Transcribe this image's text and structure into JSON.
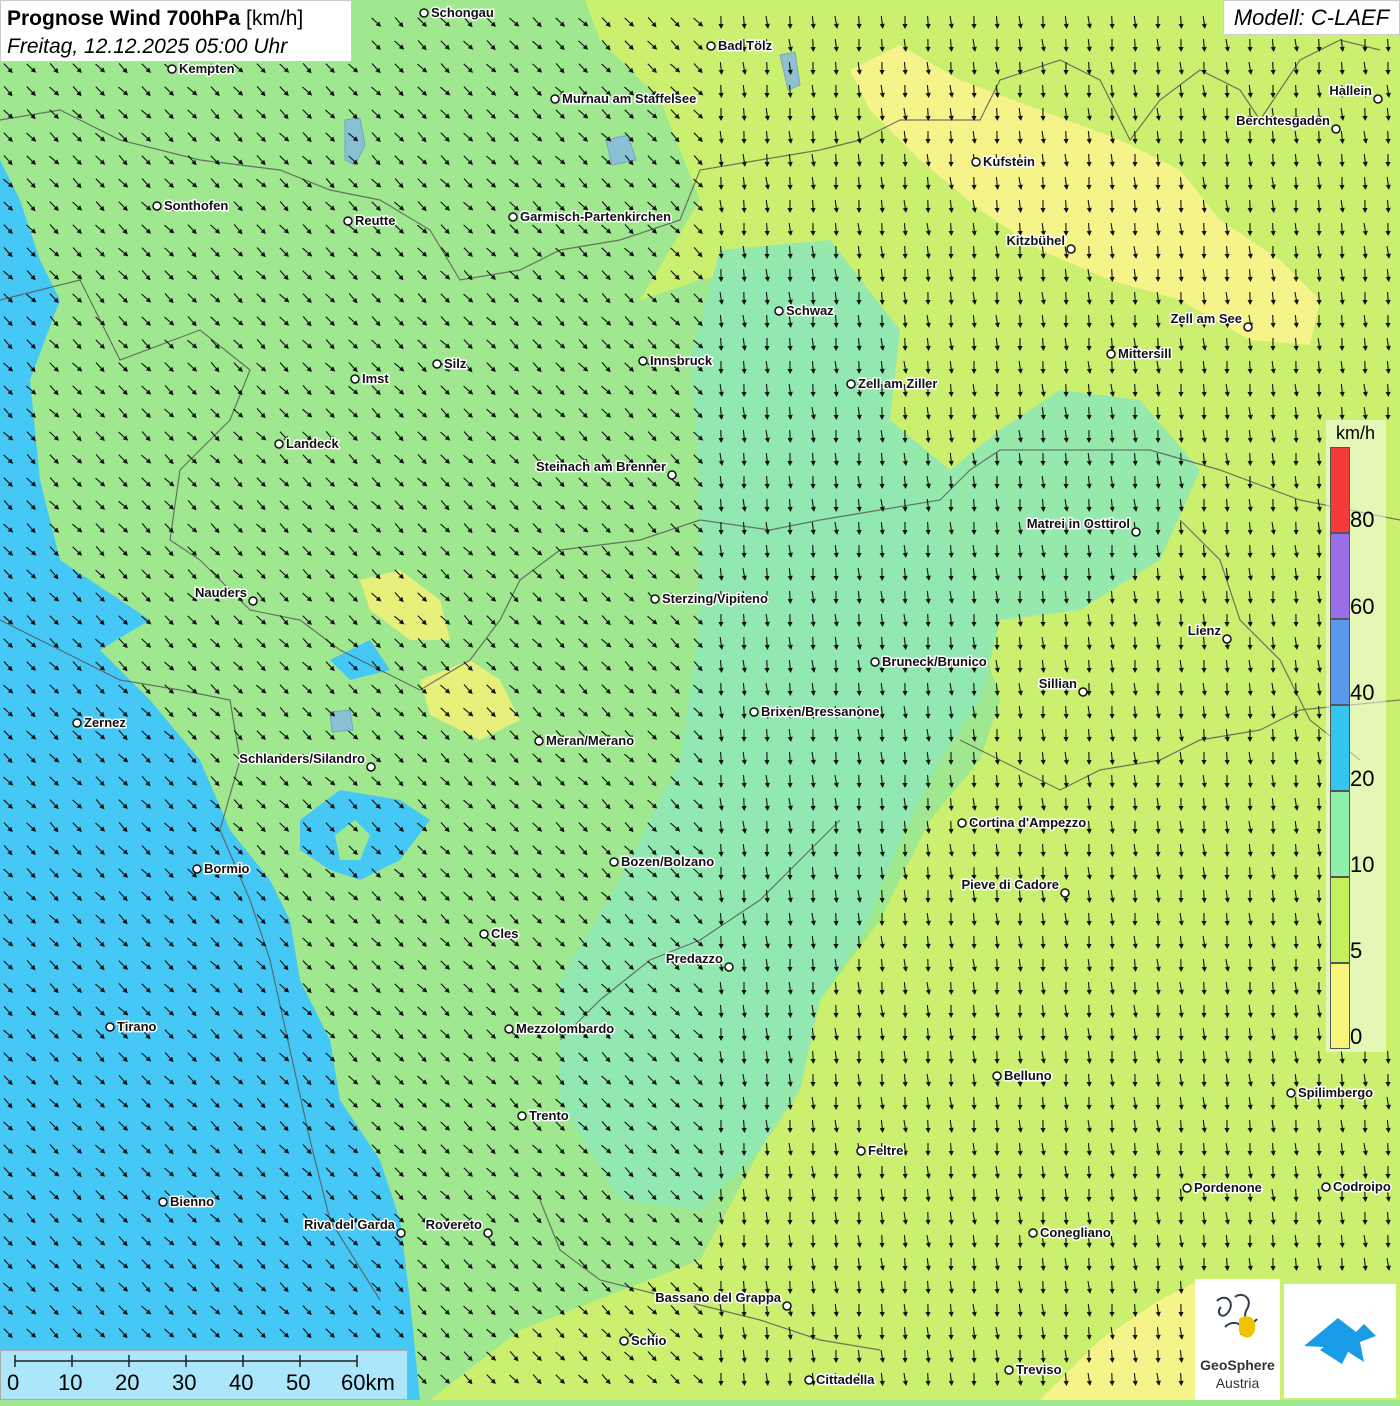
{
  "header": {
    "title_bold": "Prognose Wind 700hPa",
    "title_unit": " [km/h]",
    "subtitle": "Freitag, 12.12.2025 05:00 Uhr",
    "model": "Modell: C-LAEF"
  },
  "colors": {
    "blue_zone": "#45c8f5",
    "green_zone": "#9fe88f",
    "teal_zone": "#8fe8b4",
    "lime_zone": "#cbef6f",
    "yellow_zone": "#f5f38a",
    "arrow": "#111111"
  },
  "wind_field": {
    "direction": "light NW to N wind, arrows pointing toward SE and S",
    "west_direction": "SE",
    "east_direction": "S"
  },
  "cities": [
    {
      "name": "Schongau",
      "label_side": "right"
    },
    {
      "name": "Bad Tölz",
      "label_side": "right"
    },
    {
      "name": "Kempten",
      "label_side": "right"
    },
    {
      "name": "Murnau am Staffelsee",
      "label_side": "right"
    },
    {
      "name": "Hallein",
      "label_side": "left"
    },
    {
      "name": "Berchtesgaden",
      "label_side": "left"
    },
    {
      "name": "Kufstein",
      "label_side": "right"
    },
    {
      "name": "Sonthofen",
      "label_side": "right"
    },
    {
      "name": "Reutte",
      "label_side": "right"
    },
    {
      "name": "Garmisch-Partenkirchen",
      "label_side": "right"
    },
    {
      "name": "Kitzbühel",
      "label_side": "left"
    },
    {
      "name": "Schwaz",
      "label_side": "right"
    },
    {
      "name": "Zell am See",
      "label_side": "left"
    },
    {
      "name": "Innsbruck",
      "label_side": "right"
    },
    {
      "name": "Silz",
      "label_side": "right"
    },
    {
      "name": "Mittersill",
      "label_side": "right"
    },
    {
      "name": "Imst",
      "label_side": "right"
    },
    {
      "name": "Zell am Ziller",
      "label_side": "right"
    },
    {
      "name": "Landeck",
      "label_side": "right"
    },
    {
      "name": "Steinach am Brenner",
      "label_side": "left"
    },
    {
      "name": "Matrei in Osttirol",
      "label_side": "left"
    },
    {
      "name": "Nauders",
      "label_side": "left"
    },
    {
      "name": "Sterzing/Vipiteno",
      "label_side": "right"
    },
    {
      "name": "Lienz",
      "label_side": "left"
    },
    {
      "name": "Bruneck/Brunico",
      "label_side": "right"
    },
    {
      "name": "Sillian",
      "label_side": "left"
    },
    {
      "name": "Brixen/Bressanone",
      "label_side": "right"
    },
    {
      "name": "Zernez",
      "label_side": "right"
    },
    {
      "name": "Meran/Merano",
      "label_side": "right"
    },
    {
      "name": "Schlanders/Silandro",
      "label_side": "left"
    },
    {
      "name": "Cortina d'Ampezzo",
      "label_side": "right"
    },
    {
      "name": "Bozen/Bolzano",
      "label_side": "right"
    },
    {
      "name": "Bormio",
      "label_side": "right"
    },
    {
      "name": "Pieve di Cadore",
      "label_side": "left"
    },
    {
      "name": "Cles",
      "label_side": "right"
    },
    {
      "name": "Predazzo",
      "label_side": "left"
    },
    {
      "name": "Tirano",
      "label_side": "right"
    },
    {
      "name": "Mezzolombardo",
      "label_side": "right"
    },
    {
      "name": "Belluno",
      "label_side": "right"
    },
    {
      "name": "Spilimbergo",
      "label_side": "right"
    },
    {
      "name": "Trento",
      "label_side": "right"
    },
    {
      "name": "Feltre",
      "label_side": "right"
    },
    {
      "name": "Pordenone",
      "label_side": "right"
    },
    {
      "name": "Codroipo",
      "label_side": "right"
    },
    {
      "name": "Bienno",
      "label_side": "right"
    },
    {
      "name": "Riva del Garda",
      "label_side": "left"
    },
    {
      "name": "Rovereto",
      "label_side": "left"
    },
    {
      "name": "Conegliano",
      "label_side": "right"
    },
    {
      "name": "Bassano del Grappa",
      "label_side": "left"
    },
    {
      "name": "Schio",
      "label_side": "right"
    },
    {
      "name": "Treviso",
      "label_side": "right"
    },
    {
      "name": "Cittadella",
      "label_side": "right"
    }
  ],
  "legend": {
    "unit": "km/h",
    "bins": [
      {
        "color": "#f53a3a"
      },
      {
        "color": "#9a6ee8"
      },
      {
        "color": "#5b97ee"
      },
      {
        "color": "#34c4f0"
      },
      {
        "color": "#8ff0ab"
      },
      {
        "color": "#c4f05e"
      },
      {
        "color": "#f7f57a"
      }
    ],
    "tick_labels": [
      "80",
      "60",
      "40",
      "20",
      "10",
      "5",
      "0"
    ]
  },
  "scale": {
    "labels": [
      "0",
      "10",
      "20",
      "30",
      "40",
      "50",
      "60km"
    ]
  },
  "logos": {
    "geosphere_line1": "GeoSphere",
    "geosphere_line2": "Austria"
  }
}
